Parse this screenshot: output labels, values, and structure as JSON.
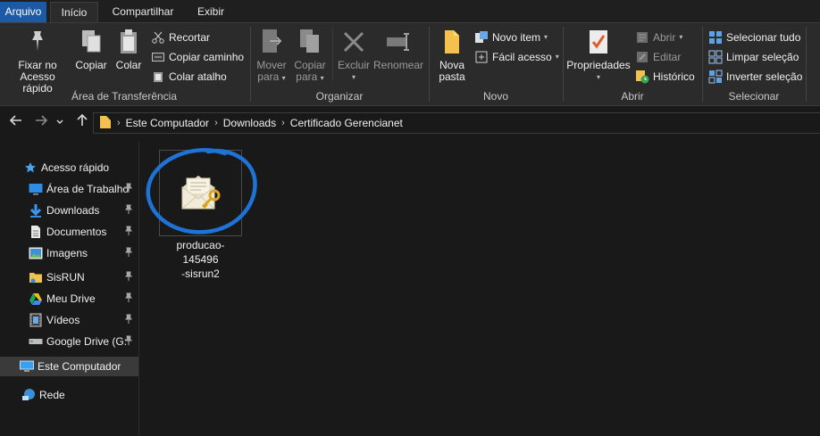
{
  "tabs": {
    "file": "Arquivo",
    "home": "Início",
    "share": "Compartilhar",
    "view": "Exibir"
  },
  "ribbon": {
    "clipboard": {
      "pin_label_1": "Fixar no",
      "pin_label_2": "Acesso rápido",
      "copy": "Copiar",
      "paste": "Colar",
      "cut": "Recortar",
      "copy_path": "Copiar caminho",
      "paste_shortcut": "Colar atalho",
      "group": "Área de Transferência"
    },
    "organize": {
      "move_1": "Mover",
      "move_2": "para",
      "copy_1": "Copiar",
      "copy_2": "para",
      "delete": "Excluir",
      "rename": "Renomear",
      "group": "Organizar"
    },
    "new": {
      "folder_1": "Nova",
      "folder_2": "pasta",
      "new_item": "Novo item",
      "easy_access": "Fácil acesso",
      "group": "Novo"
    },
    "open": {
      "properties": "Propriedades",
      "open": "Abrir",
      "edit": "Editar",
      "history": "Histórico",
      "group": "Abrir"
    },
    "select": {
      "select_all": "Selecionar tudo",
      "select_none": "Limpar seleção",
      "invert": "Inverter seleção",
      "group": "Selecionar"
    }
  },
  "address": {
    "crumbs": [
      "Este Computador",
      "Downloads",
      "Certificado Gerencianet"
    ]
  },
  "nav": {
    "quick_access": "Acesso rápido",
    "items": [
      {
        "label": "Área de Trabalho",
        "icon": "desktop-icon",
        "pinned": true
      },
      {
        "label": "Downloads",
        "icon": "download-icon",
        "pinned": true
      },
      {
        "label": "Documentos",
        "icon": "document-icon",
        "pinned": true
      },
      {
        "label": "Imagens",
        "icon": "image-icon",
        "pinned": true
      },
      {
        "label": "SisRUN",
        "icon": "folder-icon",
        "pinned": true
      },
      {
        "label": "Meu Drive",
        "icon": "google-drive-icon",
        "pinned": true
      },
      {
        "label": "Vídeos",
        "icon": "video-icon",
        "pinned": true
      },
      {
        "label": "Google Drive (G:",
        "icon": "drive-icon",
        "pinned": true
      }
    ],
    "this_pc": "Este Computador",
    "network": "Rede"
  },
  "files": [
    {
      "name": "producao-145496-sisrun2",
      "line1": "producao-145496",
      "line2": "-sisrun2",
      "icon": "certificate-icon"
    }
  ],
  "colors": {
    "file_tab": "#1c5aa6",
    "annotation_circle": "#1e73d6",
    "background": "#191919",
    "ribbon": "#2b2b2b"
  }
}
